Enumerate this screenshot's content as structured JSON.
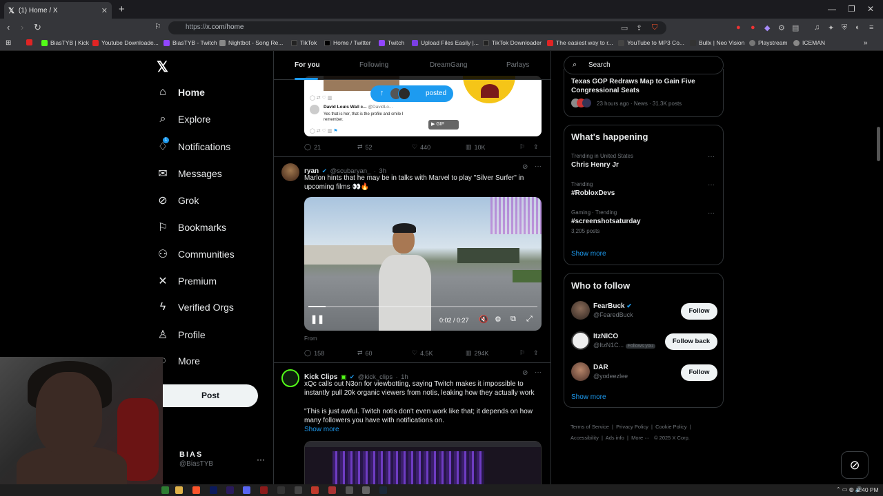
{
  "browser": {
    "tab_title": "(1) Home / X",
    "url_scheme": "https://",
    "url_rest": "x.com/home",
    "bookmarks": [
      {
        "label": "BiasTYB | Kick",
        "color": "#53fc18"
      },
      {
        "label": "Youtube Downloade...",
        "color": "#e02424"
      },
      {
        "label": "BiasTYB - Twitch",
        "color": "#9146ff"
      },
      {
        "label": "Nightbot - Song Re...",
        "color": "#888888"
      },
      {
        "label": "TikTok",
        "color": "#222222"
      },
      {
        "label": "Home / Twitter",
        "color": "#000000"
      },
      {
        "label": "Twitch",
        "color": "#9146ff"
      },
      {
        "label": "Upload Files Easily |...",
        "color": "#7b3fe4"
      },
      {
        "label": "TikTok Downloader",
        "color": "#222222"
      },
      {
        "label": "The easiest way to r...",
        "color": "#e02424"
      },
      {
        "label": "YouTube to MP3 Co...",
        "color": "#444444"
      },
      {
        "label": "Bullx | Neo Vision",
        "color": "#333333"
      },
      {
        "label": "Playstream",
        "color": "#777777"
      },
      {
        "label": "ICEMAN",
        "color": "#888888"
      }
    ]
  },
  "nav": {
    "items": [
      {
        "label": "Home",
        "icon": "home-icon",
        "glyph": "⌂"
      },
      {
        "label": "Explore",
        "icon": "search-icon",
        "glyph": "⌕"
      },
      {
        "label": "Notifications",
        "icon": "bell-icon",
        "glyph": "🔔"
      },
      {
        "label": "Messages",
        "icon": "mail-icon",
        "glyph": "✉"
      },
      {
        "label": "Grok",
        "icon": "grok-icon",
        "glyph": "⊘"
      },
      {
        "label": "Bookmarks",
        "icon": "bookmark-icon",
        "glyph": "⚐"
      },
      {
        "label": "Communities",
        "icon": "people-icon",
        "glyph": "⚇"
      },
      {
        "label": "Premium",
        "icon": "x-icon",
        "glyph": "✕"
      },
      {
        "label": "Verified Orgs",
        "icon": "lightning-icon",
        "glyph": "ϟ"
      },
      {
        "label": "Profile",
        "icon": "person-icon",
        "glyph": "♙"
      },
      {
        "label": "More",
        "icon": "more-circle-icon",
        "glyph": "⋯"
      }
    ],
    "notif_badge": "1",
    "post_label": "Post",
    "account_name": "BIAS",
    "account_handle": "@BiasTYB"
  },
  "timeline": {
    "tabs": [
      "For you",
      "Following",
      "DreamGang",
      "Parlays"
    ],
    "posted_label": "posted",
    "quote_card": {
      "author": "David Louis Wall c...",
      "author_handle": "@DavidLo...",
      "text": "Yes that is her, that is the profile and smile I remember.",
      "gif_label": "GIF"
    },
    "tweet0_stats": {
      "replies": "21",
      "reposts": "52",
      "likes": "440",
      "views": "10K"
    },
    "tweet1": {
      "name": "ryan",
      "handle": "@scubaryan_",
      "time": "3h",
      "text": "Marlon hints that he may be in talks with Marvel to play \"Silver Surfer\" in upcoming films 👀🔥",
      "video_time": "0:02 / 0:27",
      "video_progress": 0.074,
      "from_label": "From",
      "replies": "158",
      "reposts": "60",
      "likes": "4.5K",
      "views": "294K"
    },
    "tweet2": {
      "name": "Kick Clips",
      "handle": "@kick_clips",
      "time": "1h",
      "text1": "xQc calls out N3on for viewbotting, saying Twitch makes it impossible to instantly pull 20k organic viewers from notis, leaking how they actually work",
      "text2": "\"This is just awful. Twitch notis don't even work like that; it depends on how many followers you have with notifications on.",
      "show_more": "Show more"
    }
  },
  "right": {
    "search_placeholder": "Search",
    "top_trend": {
      "title": "Texas GOP Redraws Map to Gain Five Congressional Seats",
      "meta": "23 hours ago · News · 31.3K posts"
    },
    "happening_title": "What's happening",
    "trends": [
      {
        "meta": "Trending in United States",
        "title": "Chris Henry Jr",
        "posts": ""
      },
      {
        "meta": "Trending",
        "title": "#RobloxDevs",
        "posts": ""
      },
      {
        "meta": "Gaming · Trending",
        "title": "#screenshotsaturday",
        "posts": "3,205 posts"
      }
    ],
    "show_more": "Show more",
    "wtf_title": "Who to follow",
    "follow": [
      {
        "name": "FearBuck",
        "handle": "@FearedBuck",
        "button": "Follow",
        "follows_you": ""
      },
      {
        "name": "ItzNICO",
        "handle": "@ItzN1C...",
        "button": "Follow back",
        "follows_you": "Follows you"
      },
      {
        "name": "DAR",
        "handle": "@yodeezlee",
        "button": "Follow",
        "follows_you": ""
      }
    ],
    "wtf_show_more": "Show more",
    "footer": {
      "l1": [
        "Terms of Service",
        "Privacy Policy",
        "Cookie Policy"
      ],
      "l2": [
        "Accessibility",
        "Ads info",
        "More ···",
        "© 2025 X Corp."
      ]
    }
  },
  "taskbar": {
    "time": "2:40 PM"
  },
  "colors": {
    "accent": "#1d9bf0",
    "bg": "#000000",
    "muted": "#71767b"
  }
}
